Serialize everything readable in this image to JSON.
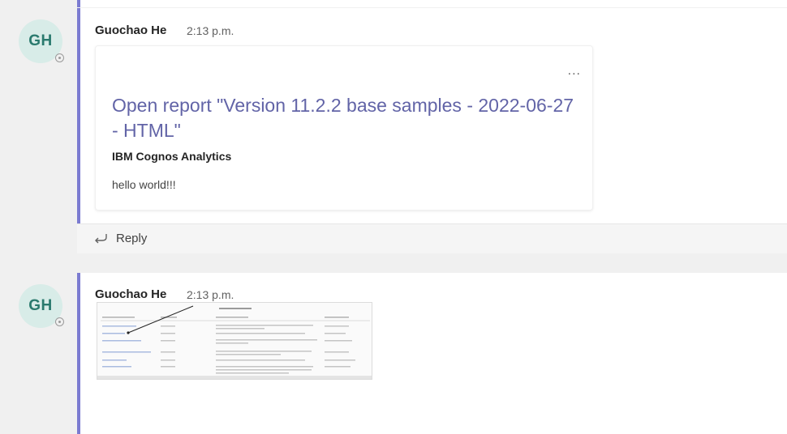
{
  "messages": [
    {
      "avatar_initials": "GH",
      "sender": "Guochao He",
      "time": "2:13 p.m.",
      "card": {
        "more_label": "...",
        "title": "Open report \"Version 11.2.2 base samples - 2022-06-27 - HTML\"",
        "subtitle": "IBM Cognos Analytics",
        "text": "hello world!!!"
      },
      "reply_label": "Reply"
    },
    {
      "avatar_initials": "GH",
      "sender": "Guochao He",
      "time": "2:13 p.m.",
      "attachment": "report-screenshot-thumbnail"
    }
  ],
  "colors": {
    "accent": "#7b7bd1",
    "link": "#6264a7",
    "avatar_bg": "#d8ece8",
    "avatar_text": "#2a7a6e",
    "background": "#f0f0f0"
  },
  "icons": {
    "reply": "reply-arrow-icon",
    "more": "more-options-icon",
    "presence": "presence-status-icon"
  }
}
